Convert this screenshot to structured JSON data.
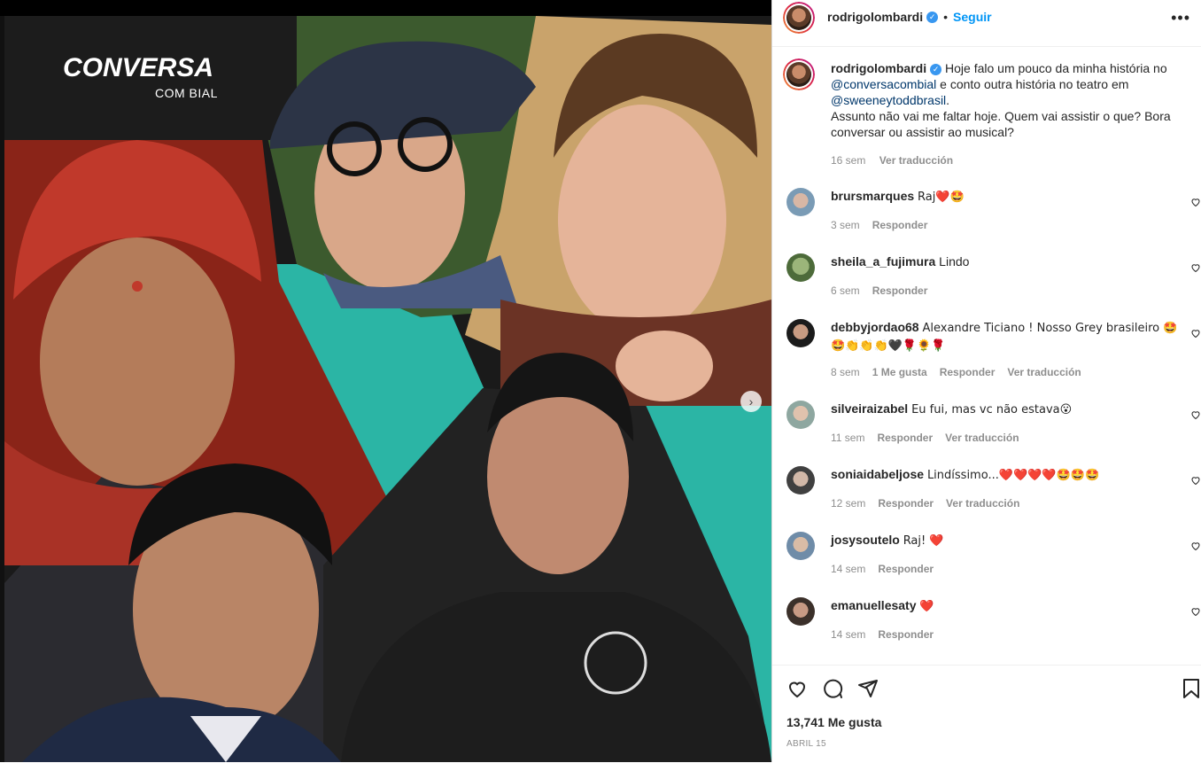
{
  "post": {
    "username": "rodrigolombardi",
    "follow_label": "Seguir",
    "dot": "•",
    "more_label": "•••",
    "brand_title": "CONVERSA",
    "brand_subtitle": "COM BIAL",
    "next_icon": "›"
  },
  "caption": {
    "username": "rodrigolombardi",
    "text_1": "Hoje falo um pouco da minha história no",
    "mention_1": "@conversacombial",
    "text_2": "e conto outra história no teatro em",
    "mention_2": "@sweeneytoddbrasil",
    "text_3": ".",
    "text_4": "Assunto não vai me faltar hoje. Quem vai assistir o que? Bora conversar ou assistir ao musical?",
    "time": "16 sem",
    "translate": "Ver traducción"
  },
  "comments": [
    {
      "user": "brursmarques",
      "text": "Raj❤️🤩",
      "time": "3 sem",
      "reply": "Responder",
      "likes": "",
      "translate": ""
    },
    {
      "user": "sheila_a_fujimura",
      "text": "Lindo",
      "time": "6 sem",
      "reply": "Responder",
      "likes": "",
      "translate": ""
    },
    {
      "user": "debbyjordao68",
      "text": "Alexandre Ticiano ! Nosso Grey brasileiro 🤩 🤩👏👏👏🖤🌹🌻🌹",
      "time": "8 sem",
      "reply": "Responder",
      "likes": "1 Me gusta",
      "translate": "Ver traducción"
    },
    {
      "user": "silveiraizabel",
      "text": "Eu fui, mas vc não estava😮",
      "time": "11 sem",
      "reply": "Responder",
      "likes": "",
      "translate": "Ver traducción"
    },
    {
      "user": "soniaidabeljose",
      "text": "Lindíssimo...❤️❤️❤️❤️🤩🤩🤩",
      "time": "12 sem",
      "reply": "Responder",
      "likes": "",
      "translate": "Ver traducción"
    },
    {
      "user": "josysoutelo",
      "text": "Raj! ❤️",
      "time": "14 sem",
      "reply": "Responder",
      "likes": "",
      "translate": ""
    },
    {
      "user": "emanuellesaty",
      "text": "❤️",
      "time": "14 sem",
      "reply": "Responder",
      "likes": "",
      "translate": ""
    }
  ],
  "footer": {
    "likes": "13,741 Me gusta",
    "date": "ABRIL 15"
  },
  "colors": {
    "accent": "#0095f6",
    "teal": "#2bb5a5",
    "muted": "#8e8e8e"
  }
}
